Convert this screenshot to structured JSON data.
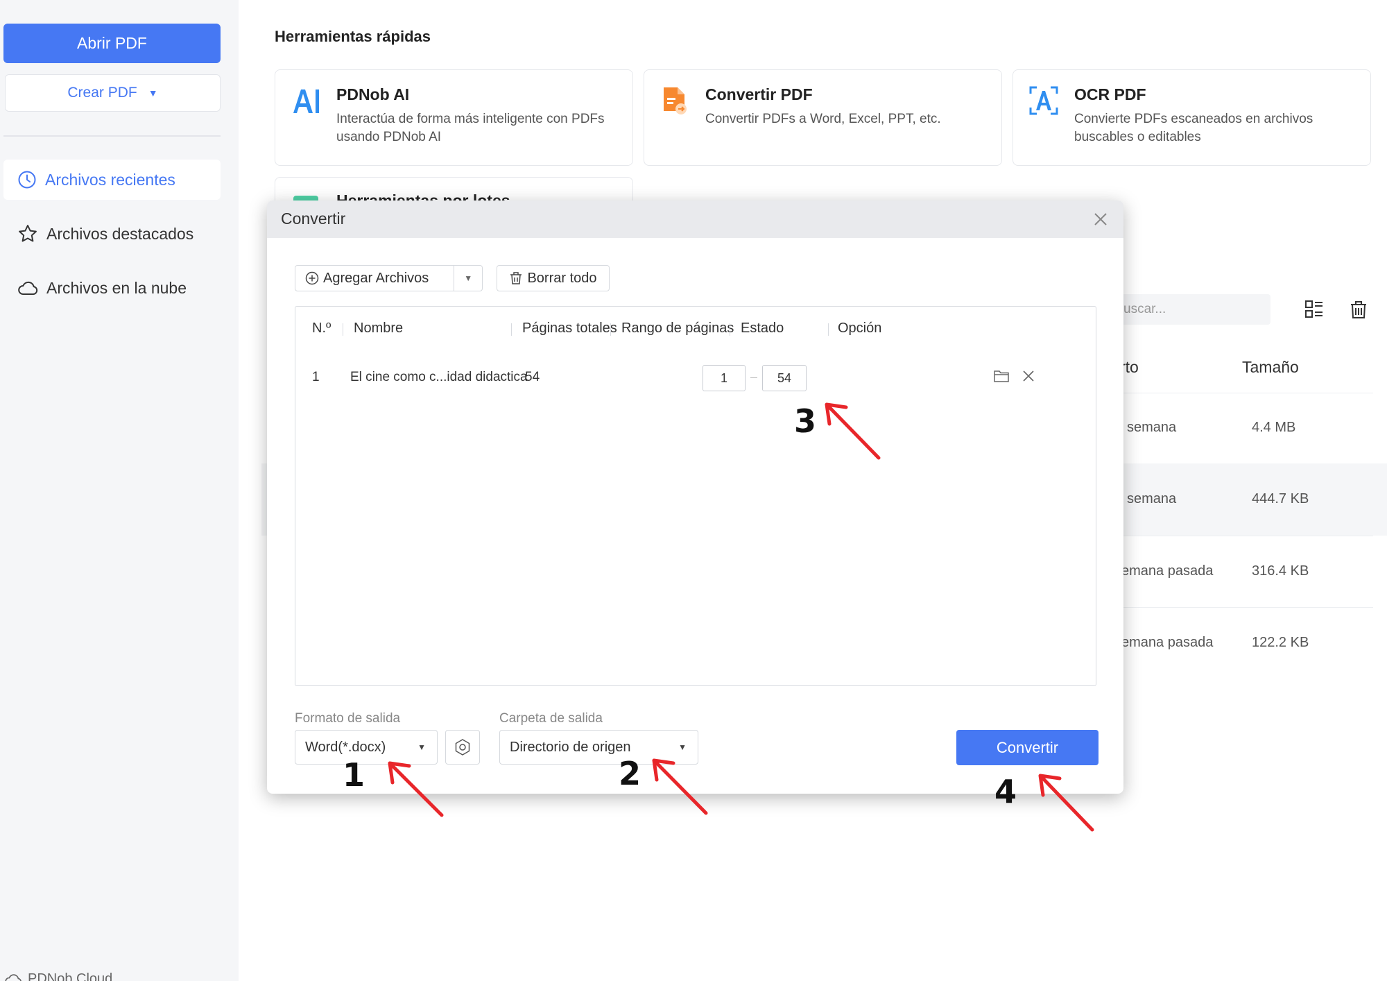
{
  "sidebar": {
    "open_pdf": "Abrir PDF",
    "create_pdf": "Crear PDF",
    "items": [
      {
        "label": "Archivos recientes",
        "icon": "clock-icon",
        "active": true
      },
      {
        "label": "Archivos destacados",
        "icon": "star-icon",
        "active": false
      },
      {
        "label": "Archivos en la nube",
        "icon": "cloud-icon",
        "active": false
      }
    ],
    "footer": "PDNob Cloud"
  },
  "quick_tools": {
    "title": "Herramientas rápidas",
    "cards": [
      {
        "title": "PDNob AI",
        "desc": "Interactúa de forma más inteligente con PDFs usando PDNob AI",
        "icon": "ai-icon"
      },
      {
        "title": "Convertir PDF",
        "desc": "Convertir PDFs a Word, Excel, PPT, etc.",
        "icon": "convert-pdf-icon"
      },
      {
        "title": "OCR PDF",
        "desc": "Convierte PDFs escaneados en archivos buscables o editables",
        "icon": "ocr-icon"
      },
      {
        "title": "Herramientas por lotes",
        "desc": "",
        "icon": "batch-icon"
      }
    ]
  },
  "files": {
    "search_placeholder": "uscar...",
    "headers": {
      "opened": "rto",
      "size": "Tamaño"
    },
    "rows": [
      {
        "opened": "semana",
        "size": "4.4 MB"
      },
      {
        "opened": "semana",
        "size": "444.7 KB"
      },
      {
        "opened": "emana pasada",
        "size": "316.4 KB"
      },
      {
        "opened": "emana pasada",
        "size": "122.2 KB"
      }
    ]
  },
  "dialog": {
    "title": "Convertir",
    "add_files": "Agregar Archivos",
    "clear_all": "Borrar todo",
    "columns": {
      "no": "N.º",
      "name": "Nombre",
      "pages": "Páginas totales",
      "range": "Rango de páginas",
      "status": "Estado",
      "option": "Opción"
    },
    "rows": [
      {
        "no": "1",
        "name": "El cine como c...idad didactica",
        "pages": "54",
        "range_start": "1",
        "range_end": "54",
        "status": ""
      }
    ],
    "output_format_label": "Formato de salida",
    "output_format_value": "Word(*.docx)",
    "output_folder_label": "Carpeta de salida",
    "output_folder_value": "Directorio de origen",
    "convert_button": "Convertir"
  },
  "annotations": [
    "1",
    "2",
    "3",
    "4"
  ],
  "colors": {
    "accent": "#4678f3",
    "arrow": "#e8262a"
  }
}
